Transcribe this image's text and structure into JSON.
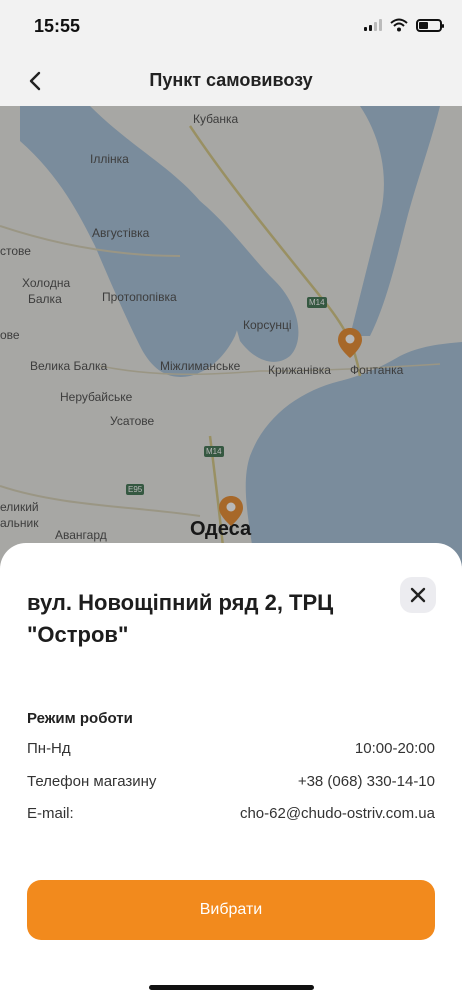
{
  "status_bar": {
    "time": "15:55"
  },
  "nav": {
    "title": "Пункт самовивозу",
    "back_icon": "chevron-left-icon"
  },
  "map": {
    "labels": {
      "kubanka": "Кубанка",
      "ilinka": "Іллінка",
      "avhustivka": "Августівка",
      "stove": "стове",
      "kholodna": "Холодна",
      "balka": "Балка",
      "protopopivka": "Протопопівка",
      "ove": "ове",
      "korsuntsi": "Корсунці",
      "velyka_balka": "Велика Балка",
      "mizhlymanske": "Міжлиманське",
      "kryzhanivka": "Крижанівка",
      "fontanka": "Фонтанка",
      "nerubaiske": "Нерубайське",
      "usatove": "Усатове",
      "velykyi": "еликий",
      "dalnyk": "альник",
      "avanhard": "Авангард",
      "odesa": "Одеса"
    },
    "road_badges": {
      "m14_top": "M14",
      "m14_mid": "M14",
      "e95": "E95"
    },
    "pin_color": "#e8913a"
  },
  "store": {
    "address": "вул. Новощіпний ряд 2, ТРЦ \"Остров\"",
    "hours_heading": "Режим роботи",
    "rows": [
      {
        "label": "Пн-Нд",
        "value": "10:00-20:00"
      },
      {
        "label": "Телефон магазину",
        "value": "+38 (068) 330-14-10"
      },
      {
        "label": "E-mail:",
        "value": "cho-62@chudo-ostriv.com.ua"
      }
    ],
    "select_label": "Вибрати",
    "close_icon": "close-icon"
  },
  "colors": {
    "accent": "#f28a1d",
    "water": "#a9c2d8",
    "land": "#e8e8e3"
  }
}
